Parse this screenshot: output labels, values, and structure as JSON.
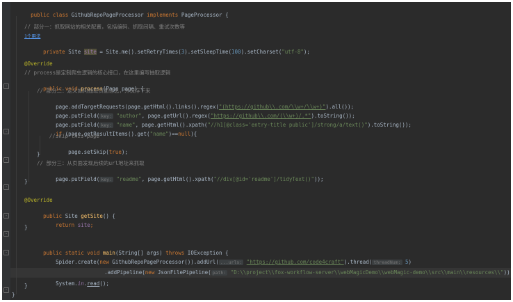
{
  "code": {
    "class_decl": {
      "kw1": "public class",
      "name": "GithubRepoPageProcessor",
      "kw2": "implements",
      "iface": "PageProcessor",
      "brace": "{"
    },
    "comment_part1": "// 部分一：抓取网站的相关配置，包括编码、抓取间隔、重试次数等",
    "usages": "1个用法",
    "site_field": {
      "kw": "private",
      "type": "Site",
      "name": "site",
      "eq": " = Site.me().setRetryTimes(",
      "n1": "3",
      "mid1": ").setSleepTime(",
      "n2": "100",
      "mid2": ").setCharset(",
      "s1": "\"utf-8\"",
      "end": ");"
    },
    "override1": "@Override",
    "comment_process": "// process是定制爬虫逻辑的核心接口，在这里编写抽取逻辑",
    "process_decl": {
      "kw": "public void",
      "name": "process",
      "params": "(Page page) {"
    },
    "comment_part2": "// 部分二：定义如何抽取页面信息，并保存下来",
    "add_target": {
      "pre": "page.addTargetRequests(page.getHtml().links().regex(",
      "s": "\"(https://github\\\\.com/\\\\w+/\\\\w+)\"",
      "end": ").all());"
    },
    "put_author": {
      "pre": "page.putField(",
      "hint": "key:",
      "s1": "\"author\"",
      "mid": ", page.getUrl().regex(",
      "s2": "\"https://github\\\\.com/(\\\\w+)/.*\"",
      "end": ").toString());"
    },
    "put_name": {
      "pre": "page.putField(",
      "hint": "key:",
      "s1": "\"name\"",
      "mid": ", page.getHtml().xpath(",
      "s2": "\"//h1[@class='entry-title public']/strong/a/text()\"",
      "end": ").toString());"
    },
    "if_line": {
      "kw": "if",
      "pre": " (page.getResultItems().get(",
      "s": "\"name\"",
      "mid": ")==",
      "kw2": "null",
      "end": "){"
    },
    "skip_comment": "//skip this page",
    "set_skip": {
      "pre": "page.setSkip(",
      "kw": "true",
      "end": ");"
    },
    "close_if": "}",
    "comment_part3": "// 部分三：从页面发现后续的url地址来抓取",
    "put_readme": {
      "pre": "page.putField(",
      "hint": "key:",
      "s1": "\"readme\"",
      "mid": ", page.getHtml().xpath(",
      "s2": "\"//div[@id='readme']/tidyText()\"",
      "end": "));"
    },
    "close_process": "}",
    "override2": "@Override",
    "get_site_decl": {
      "kw": "public",
      "type": " Site ",
      "name": "getSite",
      "end": "() {"
    },
    "return_line": {
      "kw": "return",
      "field": "site",
      "end": ";"
    },
    "close_getsite": "}",
    "main_decl": {
      "kw": "public static void",
      "name": "main",
      "mid": "(String[] args) ",
      "kw2": "throws",
      "end": " IOException {"
    },
    "spider_line": {
      "pre": "Spider.create(",
      "kw": "new",
      "mid": " GithubRepoPageProcessor()).addUrl(",
      "hint": "...urls:",
      "s": "\"https://github.com/code4craft\"",
      "mid2": ").thread(",
      "hint2": "threadNum:",
      "n": "5",
      "end": ")"
    },
    "pipeline_line": {
      "pre": ".addPipeline(",
      "kw": "new",
      "mid": " JsonFilePipeline(",
      "hint": "path:",
      "s": "\"D:\\\\project\\\\fox-workflow-server\\\\webMagicDemo\\\\webMagic-demo\\\\src\\\\main\\\\resources\\\\\"",
      "end": ")).run();"
    },
    "system_line": {
      "pre": "System.",
      "field": "in",
      "dot": ".",
      "method": "read",
      "end": "();"
    },
    "close_main": "}",
    "close_class": "}"
  }
}
